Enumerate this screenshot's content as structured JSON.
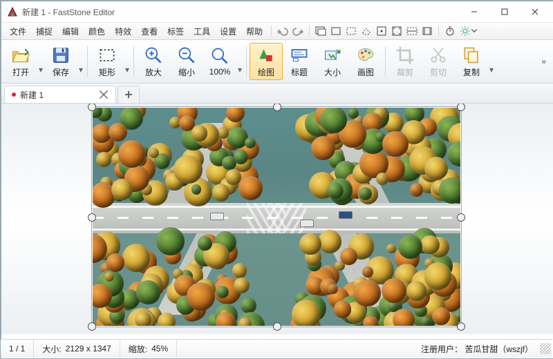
{
  "window": {
    "title": "新建 1 - FastStone Editor"
  },
  "menu": {
    "items": [
      "文件",
      "捕捉",
      "编辑",
      "颜色",
      "特效",
      "查看",
      "标签",
      "工具",
      "设置",
      "帮助"
    ]
  },
  "menuicons": [
    "undo-icon",
    "redo-icon",
    "capture-window-icon",
    "capture-rect-icon",
    "marquee-icon",
    "freeform-icon",
    "fullscreen-icon",
    "arrows-out-icon",
    "crop-tool-icon",
    "filmstrip-icon",
    "timer-icon",
    "gear-icon"
  ],
  "toolbar": {
    "open": {
      "label": "打开"
    },
    "save": {
      "label": "保存"
    },
    "rect": {
      "label": "矩形"
    },
    "zoomin": {
      "label": "放大"
    },
    "zoomout": {
      "label": "缩小"
    },
    "zoom100": {
      "label": "100%"
    },
    "draw": {
      "label": "绘图"
    },
    "caption": {
      "label": "标题"
    },
    "size": {
      "label": "大小"
    },
    "paint": {
      "label": "画图"
    },
    "crop": {
      "label": "裁剪"
    },
    "cut": {
      "label": "剪切"
    },
    "copy": {
      "label": "复制"
    }
  },
  "tabs": {
    "items": [
      {
        "label": "新建 1"
      }
    ]
  },
  "status": {
    "page": "1 / 1",
    "size_label": "大小:",
    "size_value": "2129 x 1347",
    "zoom_label": "缩放:",
    "zoom_value": "45%",
    "user_label": "注册用户：",
    "user_value": "苦瓜甘甜（wszjf）"
  }
}
